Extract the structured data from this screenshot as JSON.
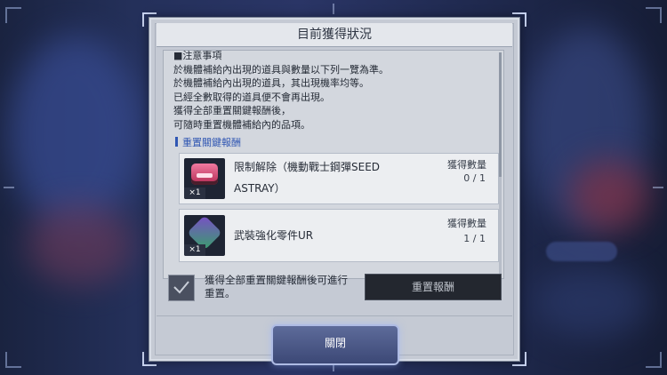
{
  "dialog": {
    "title": "目前獲得狀況",
    "notes": [
      "■注意事項",
      "於機體補給內出現的道具與數量以下列一覽為準。",
      "於機體補給內出現的道具，其出現機率均等。",
      "已經全數取得的道具便不會再出現。",
      "獲得全部重置關鍵報酬後，",
      "可隨時重置機體補給內的品項。"
    ],
    "section_title": "重置關鍵報酬",
    "items": [
      {
        "name": "限制解除（機動戰士鋼彈SEED ASTRAY）",
        "count_label": "獲得數量",
        "count": "0 / 1",
        "qty": "×1",
        "icon": "limit-break-icon"
      },
      {
        "name": "武裝強化零件UR",
        "count_label": "獲得數量",
        "count": "1 / 1",
        "qty": "×1",
        "icon": "weapon-part-icon"
      }
    ],
    "checkbox_label": "獲得全部重置關鍵報酬後可進行重置。",
    "reset_button": "重置報酬",
    "close_button": "關閉"
  },
  "colors": {
    "accent_blue": "#3157b3",
    "dialog_bg": "#c5cad4",
    "reset_button_bg": "#23272f"
  }
}
